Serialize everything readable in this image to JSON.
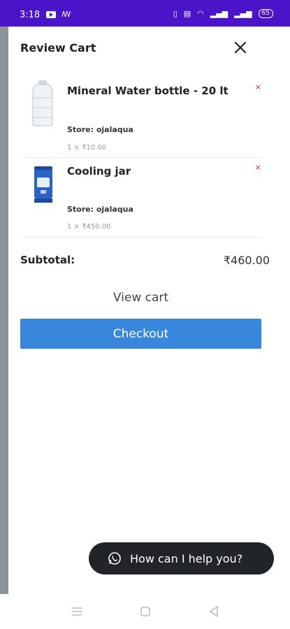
{
  "status_bar": {
    "time": "3:18",
    "left_icons": [
      "youtube-icon",
      "notification-icon"
    ],
    "right_icons": [
      "vibrate-icon",
      "volte-icon",
      "wifi-icon",
      "signal-icon",
      "signal-icon"
    ],
    "battery": "65"
  },
  "drawer": {
    "title": "Review Cart"
  },
  "cart": {
    "items": [
      {
        "name": "Mineral Water bottle - 20 lt",
        "store": "Store: ojalaqua",
        "qty_price": "1 × ₹10.00",
        "remove": "×",
        "thumb": "water-bottle-image"
      },
      {
        "name": "Cooling jar",
        "store": "Store: ojalaqua",
        "qty_price": "1 × ₹450.00",
        "remove": "×",
        "thumb": "cooling-jar-image"
      }
    ],
    "subtotal_label": "Subtotal:",
    "subtotal_value": "₹460.00",
    "view_cart": "View cart",
    "checkout": "Checkout"
  },
  "help": {
    "label": "How can I help you?",
    "icon": "whatsapp-icon"
  },
  "nav_bar": {
    "icons": [
      "menu-icon",
      "home-icon",
      "back-icon"
    ]
  },
  "colors": {
    "status_bar": "#4a14c8",
    "checkout_button": "#3987dd",
    "remove": "#dd2222",
    "help_pill": "#222528"
  }
}
